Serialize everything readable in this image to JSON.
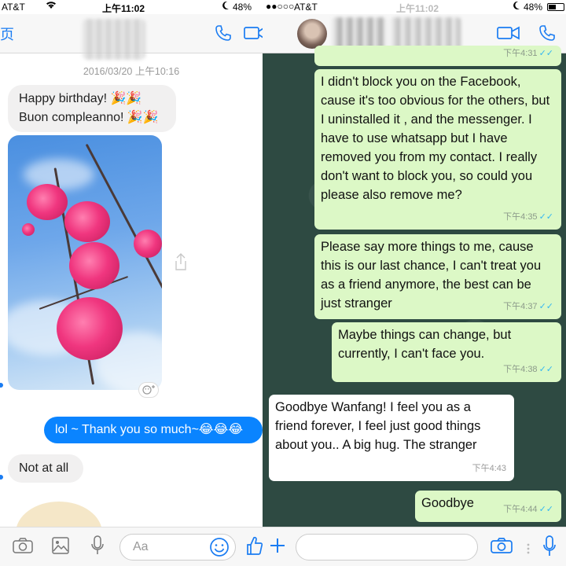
{
  "left": {
    "status": {
      "carrier": "AT&T",
      "time": "上午11:02",
      "battery": "48%"
    },
    "header": {
      "back_label": "页"
    },
    "messages": {
      "timestamp": "2016/03/20 上午10:16",
      "birthday_en": "Happy birthday! 🎉🎉",
      "birthday_it": "Buon compleanno! 🎉🎉",
      "thanks": "lol ~ Thank you so much~😂😂😂",
      "not_at_all": "Not at all"
    },
    "composer": {
      "placeholder": "Aa"
    },
    "colors": {
      "accent": "#1a7cf2",
      "outgoing": "#0a84ff"
    }
  },
  "right": {
    "status": {
      "carrier": "AT&T",
      "signal": "●●○○○",
      "time": "上午11:02",
      "battery": "48%"
    },
    "messages": [
      {
        "side": "out",
        "text": "",
        "time": "下午4:31",
        "ticks": "✓✓"
      },
      {
        "side": "out",
        "text": "I didn't block you on the Facebook, cause it's too obvious for the others, but I uninstalled it , and the messenger. I have to use whatsapp but I have removed you from my contact. I really don't want to block you, so could you please also remove me?",
        "time": "下午4:35",
        "ticks": "✓✓"
      },
      {
        "side": "out",
        "text": "Please say more things to me, cause this is our last chance, I can't treat you as a friend anymore, the best can be just stranger",
        "time": "下午4:37",
        "ticks": "✓✓"
      },
      {
        "side": "out",
        "text": "Maybe things can change, but currently, I can't face you.",
        "time": "下午4:38",
        "ticks": "✓✓"
      },
      {
        "side": "in",
        "text": "Goodbye Wanfang! I feel you as a friend forever, I feel just good things about you.. A big hug. The stranger",
        "time": "下午4:43"
      },
      {
        "side": "out",
        "text": "Goodbye",
        "time": "下午4:44",
        "ticks": "✓✓"
      }
    ],
    "colors": {
      "outgoing": "#dcf8c6",
      "incoming": "#ffffff",
      "tick": "#34b7f1",
      "accent": "#1a7cf2"
    }
  }
}
